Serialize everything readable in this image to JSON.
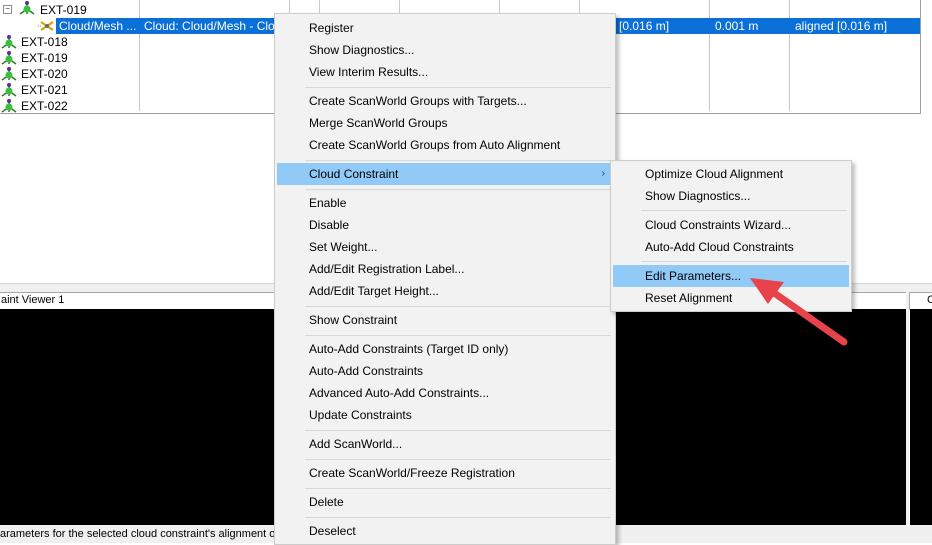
{
  "tree": {
    "parent_node": {
      "label": "EXT-019",
      "expander": "⊟"
    },
    "selected_row": {
      "name": "Cloud/Mesh ...",
      "description": "Cloud: Cloud/Mesh - Cloud",
      "col_error": "[0.016 m]",
      "col_weight": "0.001 m",
      "col_status": "aligned [0.016 m]"
    },
    "nodes": [
      {
        "label": "EXT-018"
      },
      {
        "label": "EXT-019"
      },
      {
        "label": "EXT-020"
      },
      {
        "label": "EXT-021"
      },
      {
        "label": "EXT-022"
      }
    ]
  },
  "panes": {
    "left_title": "aint Viewer 1",
    "right_title": "C"
  },
  "status_text": "arameters for the selected cloud constraint's alignment optim",
  "context_menu": {
    "items": [
      "Register",
      "Show Diagnostics...",
      "View Interim Results...",
      "Create ScanWorld Groups with Targets...",
      "Merge ScanWorld Groups",
      "Create ScanWorld Groups from Auto Alignment",
      "Cloud Constraint",
      "Enable",
      "Disable",
      "Set Weight...",
      "Add/Edit Registration Label...",
      "Add/Edit Target Height...",
      "Show Constraint",
      "Auto-Add Constraints (Target ID only)",
      "Auto-Add Constraints",
      "Advanced Auto-Add Constraints...",
      "Update Constraints",
      "Add ScanWorld...",
      "Create ScanWorld/Freeze Registration",
      "Delete",
      "Deselect"
    ],
    "submenu_indicator": "›"
  },
  "submenu": {
    "items": [
      "Optimize Cloud Alignment",
      "Show Diagnostics...",
      "Cloud Constraints Wizard...",
      "Auto-Add Cloud Constraints",
      "Edit Parameters...",
      "Reset Alignment"
    ]
  },
  "colors": {
    "selection": "#0a6fd6",
    "menu_highlight": "#91c9f7",
    "annotation_arrow": "#e8424a"
  },
  "icons": [
    "scanworld-node-icon",
    "cloud-mesh-icon",
    "submenu-arrow-icon",
    "annotation-arrow-icon"
  ]
}
